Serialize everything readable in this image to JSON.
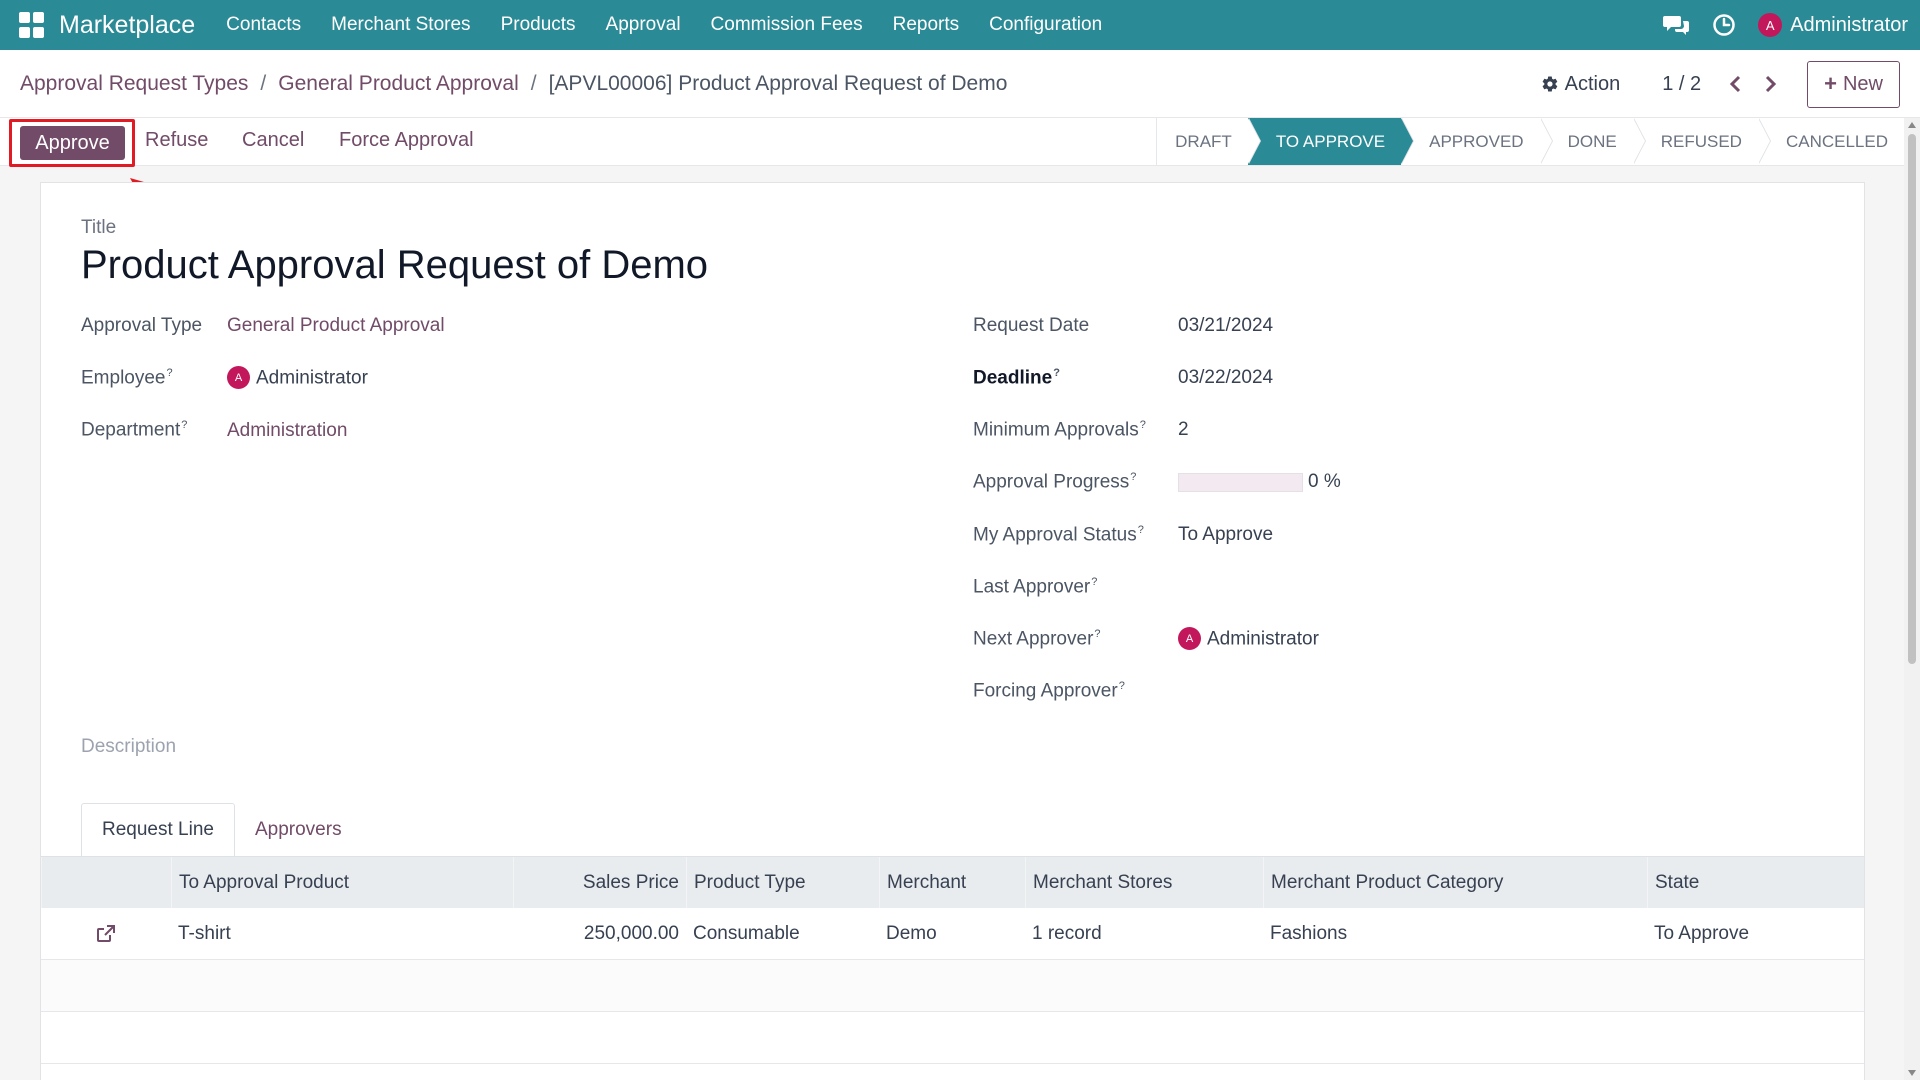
{
  "navbar": {
    "brand": "Marketplace",
    "menu": [
      "Contacts",
      "Merchant Stores",
      "Products",
      "Approval",
      "Commission Fees",
      "Reports",
      "Configuration"
    ],
    "user": {
      "initial": "A",
      "name": "Administrator"
    },
    "icons": [
      "apps-grid-icon",
      "chat-icon",
      "clock-icon"
    ]
  },
  "breadcrumb": {
    "items": [
      "Approval Request Types",
      "General Product Approval"
    ],
    "separator": "/",
    "current": "[APVL00006] Product Approval Request of Demo"
  },
  "control": {
    "action_label": "Action",
    "pager": "1 / 2",
    "new_label": "New"
  },
  "header_buttons": {
    "approve": "Approve",
    "refuse": "Refuse",
    "cancel": "Cancel",
    "force": "Force Approval"
  },
  "stages": [
    "DRAFT",
    "TO APPROVE",
    "APPROVED",
    "DONE",
    "REFUSED",
    "CANCELLED"
  ],
  "active_stage": "TO APPROVE",
  "form": {
    "title_label": "Title",
    "title": "Product Approval Request of Demo",
    "left": {
      "approval_type": {
        "label": "Approval Type",
        "value": "General Product Approval"
      },
      "employee": {
        "label": "Employee",
        "hint": "?",
        "initial": "A",
        "value": "Administrator"
      },
      "department": {
        "label": "Department",
        "hint": "?",
        "value": "Administration"
      }
    },
    "right": {
      "request_date": {
        "label": "Request Date",
        "value": "03/21/2024"
      },
      "deadline": {
        "label": "Deadline",
        "hint": "?",
        "value": "03/22/2024"
      },
      "min_approvals": {
        "label": "Minimum Approvals",
        "hint": "?",
        "value": "2"
      },
      "progress": {
        "label": "Approval Progress",
        "hint": "?",
        "value": 0,
        "text": "0 %"
      },
      "my_status": {
        "label": "My Approval Status",
        "hint": "?",
        "value": "To Approve"
      },
      "last_approver": {
        "label": "Last Approver",
        "hint": "?",
        "value": ""
      },
      "next_approver": {
        "label": "Next Approver",
        "hint": "?",
        "initial": "A",
        "value": "Administrator"
      },
      "forcing_approver": {
        "label": "Forcing Approver",
        "hint": "?",
        "value": ""
      }
    },
    "description_label": "Description"
  },
  "tabs": [
    "Request Line",
    "Approvers"
  ],
  "table": {
    "columns": [
      "",
      "To Approval Product",
      "Sales Price",
      "Product Type",
      "Merchant",
      "Merchant Stores",
      "Merchant Product Category",
      "State"
    ],
    "rows": [
      [
        "T-shirt",
        "250,000.00",
        "Consumable",
        "Demo",
        "1 record",
        "Fashions",
        "To Approve"
      ]
    ]
  },
  "colors": {
    "navbar": "#2a8a96",
    "primary": "#714b67",
    "highlight": "#e01b24"
  }
}
